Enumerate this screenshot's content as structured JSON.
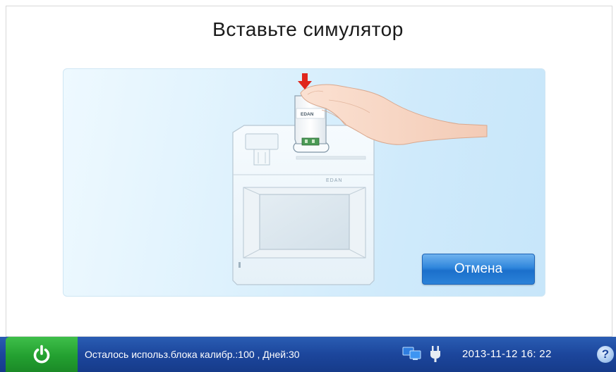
{
  "screen": {
    "title": "Вставьте симулятор"
  },
  "illustration": {
    "device_brand": "EDAN",
    "simulator_brand": "EDAN"
  },
  "buttons": {
    "cancel_label": "Отмена"
  },
  "status_bar": {
    "message": "Осталось использ.блока калибр.:100 , Дней:30",
    "datetime": "2013-11-12  16: 22",
    "help_label": "?"
  },
  "icons": {
    "power": "power-icon",
    "network": "network-icon",
    "plug": "power-plug-icon",
    "help": "help-icon",
    "arrow": "down-arrow-icon"
  },
  "colors": {
    "status_bar": "#1c469c",
    "power_button": "#23a030",
    "cancel_button": "#2f86dc",
    "arrow": "#e0261c"
  }
}
